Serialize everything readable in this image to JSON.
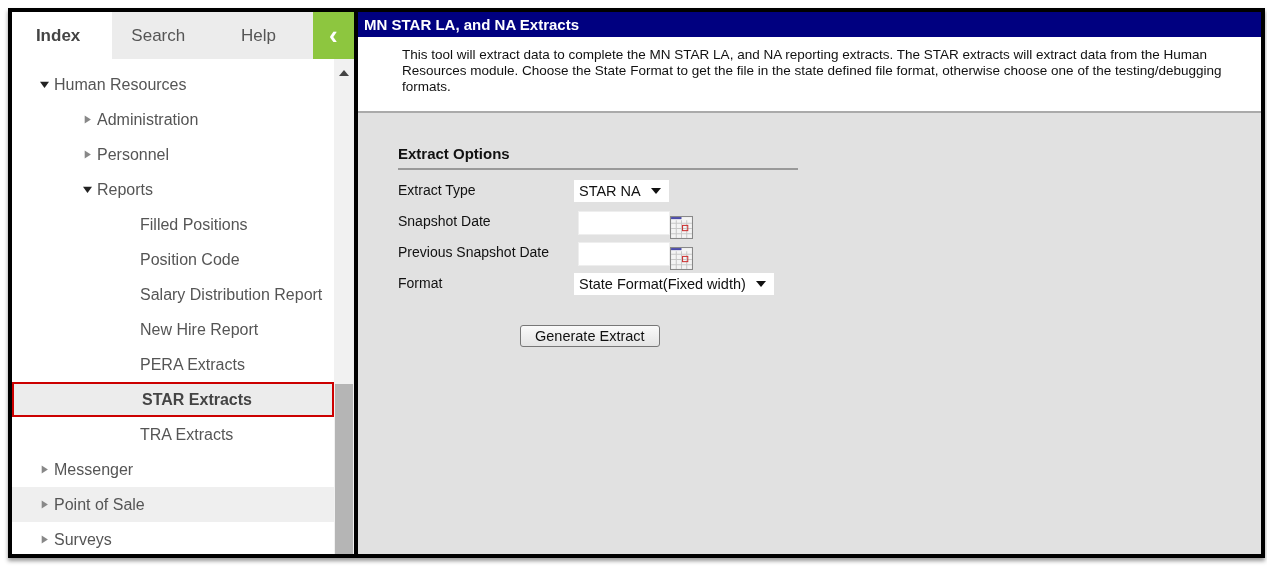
{
  "tabs": [
    {
      "label": "Index",
      "selected": true
    },
    {
      "label": "Search",
      "selected": false
    },
    {
      "label": "Help",
      "selected": false
    }
  ],
  "collapse_button": {
    "label": "‹"
  },
  "tree": [
    {
      "kind": "folder",
      "label": "Human Resources",
      "expanded": true,
      "selected": false,
      "highlighted": false,
      "children": [
        {
          "kind": "folder",
          "label": "Administration",
          "expanded": false,
          "selected": false,
          "highlighted": false
        },
        {
          "kind": "folder",
          "label": "Personnel",
          "expanded": false,
          "selected": false,
          "highlighted": false
        },
        {
          "kind": "folder",
          "label": "Reports",
          "expanded": true,
          "selected": false,
          "highlighted": false,
          "children": [
            {
              "kind": "leaf",
              "label": "Filled Positions",
              "selected": false,
              "highlighted": false
            },
            {
              "kind": "leaf",
              "label": "Position Code",
              "selected": false,
              "highlighted": false
            },
            {
              "kind": "leaf",
              "label": "Salary Distribution Report",
              "selected": false,
              "highlighted": false
            },
            {
              "kind": "leaf",
              "label": "New Hire Report",
              "selected": false,
              "highlighted": false
            },
            {
              "kind": "leaf",
              "label": "PERA Extracts",
              "selected": false,
              "highlighted": false
            },
            {
              "kind": "leaf",
              "label": "STAR Extracts",
              "selected": true,
              "highlighted": false
            },
            {
              "kind": "leaf",
              "label": "TRA Extracts",
              "selected": false,
              "highlighted": false
            }
          ]
        }
      ]
    },
    {
      "kind": "folder",
      "label": "Messenger",
      "expanded": false,
      "selected": false,
      "highlighted": false
    },
    {
      "kind": "folder",
      "label": "Point of Sale",
      "expanded": false,
      "selected": false,
      "highlighted": true
    },
    {
      "kind": "folder",
      "label": "Surveys",
      "expanded": false,
      "selected": false,
      "highlighted": false
    }
  ],
  "page": {
    "title": "MN STAR LA, and NA Extracts",
    "description": "This tool will extract data to complete the MN STAR LA, and NA reporting extracts. The STAR extracts will extract data from the Human Resources module. Choose the State Format to get the file in the state defined file format, otherwise choose one of the testing/debugging formats."
  },
  "form": {
    "heading": "Extract Options",
    "fields": [
      {
        "kind": "dropdown",
        "label": "Extract Type",
        "value": "STAR NA"
      },
      {
        "kind": "date",
        "label": "Snapshot Date"
      },
      {
        "kind": "date",
        "label": "Previous Snapshot Date"
      },
      {
        "kind": "dropdown",
        "label": "Format",
        "value": "State Format(Fixed width)"
      }
    ],
    "button": "Generate Extract"
  }
}
